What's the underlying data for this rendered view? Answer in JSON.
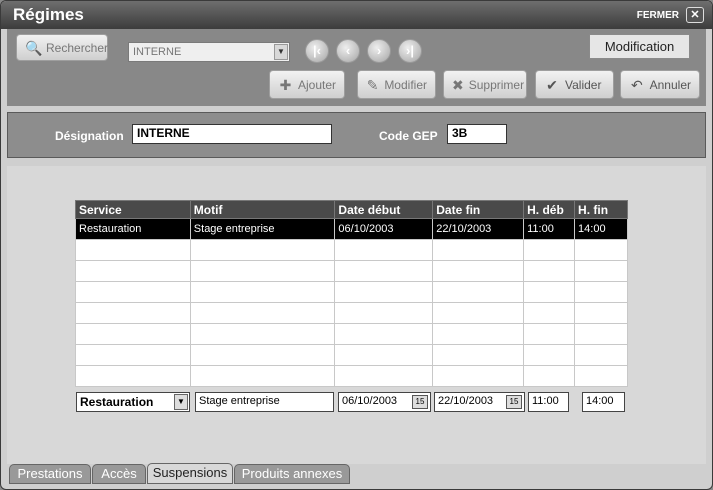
{
  "window": {
    "title": "Régimes",
    "close_label": "FERMER",
    "close_glyph": "✕"
  },
  "toolbar": {
    "search_label": "Rechercher",
    "combo_value": "INTERNE",
    "mode_label": "Modification",
    "add_label": "Ajouter",
    "edit_label": "Modifier",
    "delete_label": "Supprimer",
    "validate_label": "Valider",
    "cancel_label": "Annuler"
  },
  "form": {
    "designation_label": "Désignation",
    "designation_value": "INTERNE",
    "code_label": "Code GEP",
    "code_value": "3B"
  },
  "grid": {
    "columns": [
      "Service",
      "Motif",
      "Date début",
      "Date fin",
      "H. déb",
      "H. fin"
    ],
    "rows": [
      [
        "Restauration",
        "Stage entreprise",
        "06/10/2003",
        "22/10/2003",
        "11:00",
        "14:00"
      ]
    ]
  },
  "edit_row": {
    "service": "Restauration",
    "motif": "Stage entreprise",
    "date_debut": "06/10/2003",
    "date_fin": "22/10/2003",
    "h_deb": "11:00",
    "h_fin": "14:00",
    "cal_glyph": "15"
  },
  "tabs": [
    "Prestations",
    "Accès",
    "Suspensions",
    "Produits annexes"
  ],
  "active_tab": "Suspensions"
}
